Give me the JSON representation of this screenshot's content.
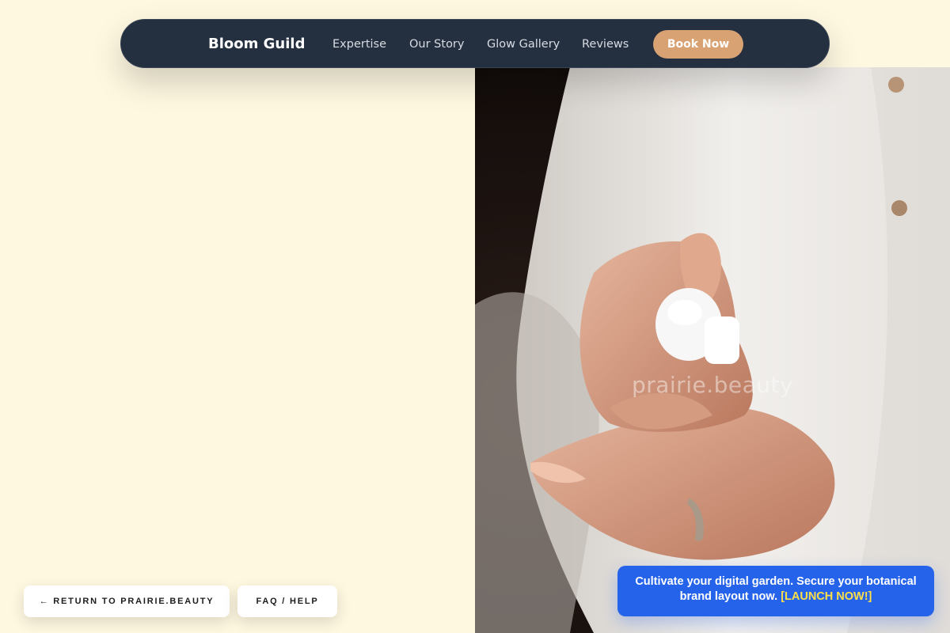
{
  "nav": {
    "brand": "Bloom Guild",
    "links": [
      "Expertise",
      "Our Story",
      "Glow Gallery",
      "Reviews"
    ],
    "cta": "Book Now"
  },
  "hero": {
    "image_icon": "hands-applying-lotion-photo",
    "watermark": "prairie.beauty"
  },
  "footer_buttons": {
    "return": "← RETURN TO PRAIRIE.BEAUTY",
    "faq": "FAQ / HELP"
  },
  "promo": {
    "text": "Cultivate your digital garden. Secure your botanical brand layout now.",
    "cta": "[LAUNCH NOW!]"
  },
  "colors": {
    "page_bg": "#fef8e1",
    "nav_bg": "#243040",
    "accent": "#d9a273",
    "promo_bg": "#2563eb",
    "promo_cta": "#fde047"
  }
}
